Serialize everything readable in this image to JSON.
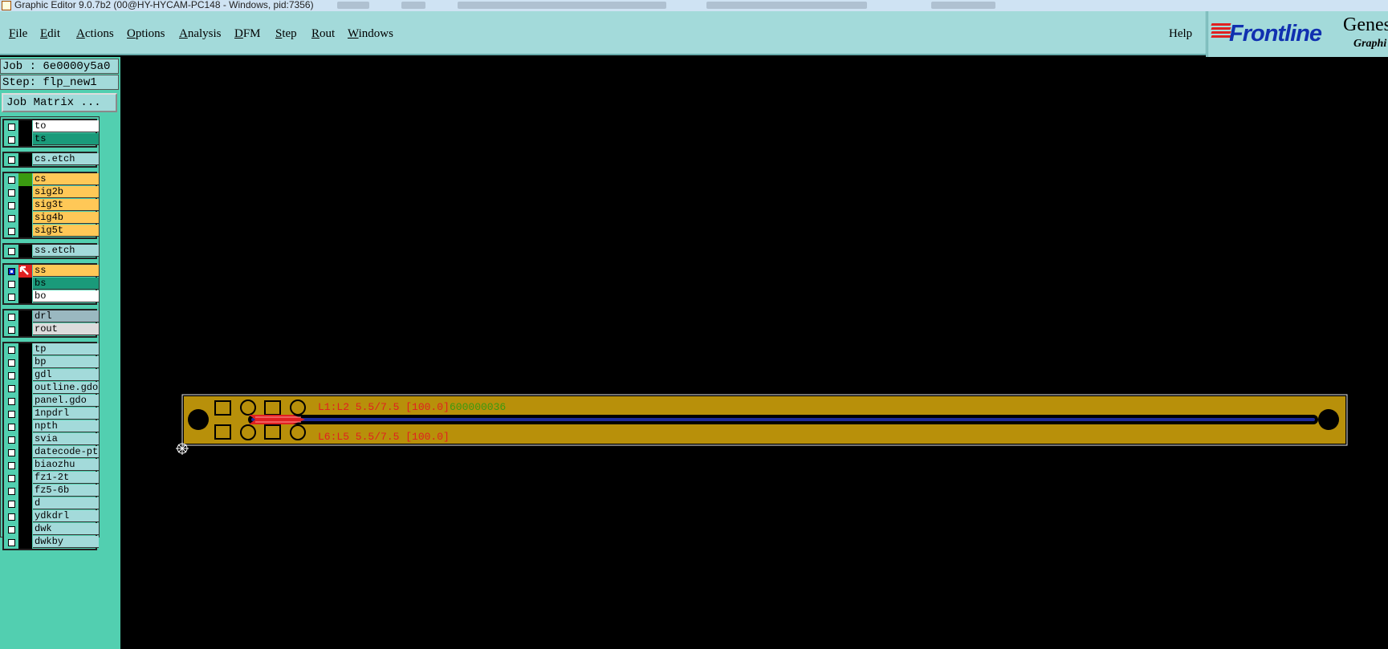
{
  "window": {
    "title": "Graphic Editor 9.0.7b2 (00@HY-HYCAM-PC148 - Windows, pid:7356)"
  },
  "menu": {
    "items": [
      {
        "first": "F",
        "rest": "ile"
      },
      {
        "first": "E",
        "rest": "dit"
      },
      {
        "first": "A",
        "rest": "ctions"
      },
      {
        "first": "O",
        "rest": "ptions"
      },
      {
        "first": "A",
        "rest": "nalysis"
      },
      {
        "first": "D",
        "rest": "FM"
      },
      {
        "first": "S",
        "rest": "tep"
      },
      {
        "first": "R",
        "rest": "out"
      },
      {
        "first": "W",
        "rest": "indows"
      }
    ],
    "help": "Help"
  },
  "logo": {
    "brand": "Frontline",
    "product": "Genes",
    "product_sub": "Graphi"
  },
  "panel": {
    "job": "Job : 6e0000y5a0",
    "step": "Step: flp_new1",
    "job_matrix": "Job Matrix ..."
  },
  "layer_groups": [
    {
      "layers": [
        {
          "name": "to",
          "bg": "#ffffff",
          "swatch": "#000000",
          "checked": false
        },
        {
          "name": "ts",
          "bg": "#1a9a7a",
          "swatch": "#000000",
          "checked": false
        }
      ]
    },
    {
      "layers": [
        {
          "name": "cs.etch",
          "bg": "#a3dada",
          "swatch": "#000000",
          "checked": false
        }
      ]
    },
    {
      "layers": [
        {
          "name": "cs",
          "bg": "#ffc857",
          "swatch": "#3a9a10",
          "checked": false
        },
        {
          "name": "sig2b",
          "bg": "#ffc857",
          "swatch": "#000000",
          "checked": false
        },
        {
          "name": "sig3t",
          "bg": "#ffc857",
          "swatch": "#000000",
          "checked": false
        },
        {
          "name": "sig4b",
          "bg": "#ffc857",
          "swatch": "#000000",
          "checked": false
        },
        {
          "name": "sig5t",
          "bg": "#ffc857",
          "swatch": "#000000",
          "checked": false
        }
      ]
    },
    {
      "layers": [
        {
          "name": "ss.etch",
          "bg": "#a3dada",
          "swatch": "#000000",
          "checked": false
        }
      ]
    },
    {
      "layers": [
        {
          "name": "ss",
          "bg": "#ffc857",
          "swatch": "#e02020",
          "checked": true
        },
        {
          "name": "bs",
          "bg": "#1a9a7a",
          "swatch": "#000000",
          "checked": false
        },
        {
          "name": "bo",
          "bg": "#ffffff",
          "swatch": "#000000",
          "checked": false
        }
      ]
    },
    {
      "layers": [
        {
          "name": "drl",
          "bg": "#9ab8c0",
          "swatch": "#000000",
          "checked": false
        },
        {
          "name": "rout",
          "bg": "#dcdcdc",
          "swatch": "#000000",
          "checked": false
        }
      ]
    },
    {
      "layers": [
        {
          "name": "tp",
          "bg": "#a3dada",
          "swatch": "#000000",
          "checked": false
        },
        {
          "name": "bp",
          "bg": "#a3dada",
          "swatch": "#000000",
          "checked": false
        },
        {
          "name": "gdl",
          "bg": "#a3dada",
          "swatch": "#000000",
          "checked": false
        },
        {
          "name": "outline.gdo",
          "bg": "#a3dada",
          "swatch": "#000000",
          "checked": false
        },
        {
          "name": "panel.gdo",
          "bg": "#a3dada",
          "swatch": "#000000",
          "checked": false
        },
        {
          "name": "1npdrl",
          "bg": "#a3dada",
          "swatch": "#000000",
          "checked": false
        },
        {
          "name": "npth",
          "bg": "#a3dada",
          "swatch": "#000000",
          "checked": false
        },
        {
          "name": "svia",
          "bg": "#a3dada",
          "swatch": "#000000",
          "checked": false
        },
        {
          "name": "datecode-ptc",
          "bg": "#a3dada",
          "swatch": "#000000",
          "checked": false
        },
        {
          "name": "biaozhu",
          "bg": "#a3dada",
          "swatch": "#000000",
          "checked": false
        },
        {
          "name": "fz1-2t",
          "bg": "#a3dada",
          "swatch": "#000000",
          "checked": false
        },
        {
          "name": "fz5-6b",
          "bg": "#a3dada",
          "swatch": "#000000",
          "checked": false
        },
        {
          "name": "d",
          "bg": "#a3dada",
          "swatch": "#000000",
          "checked": false
        },
        {
          "name": "ydkdrl",
          "bg": "#a3dada",
          "swatch": "#000000",
          "checked": false
        },
        {
          "name": "dwk",
          "bg": "#a3dada",
          "swatch": "#000000",
          "checked": false
        },
        {
          "name": "dwkby",
          "bg": "#a3dada",
          "swatch": "#000000",
          "checked": false
        }
      ]
    }
  ],
  "canvas": {
    "board_color": "#b8900a",
    "label_top": "L1:L2 5.5/7.5 [100.0]",
    "label_top_overlap": "600000036",
    "label_bottom": "L6:L5 5.5/7.5 [100.0]"
  }
}
